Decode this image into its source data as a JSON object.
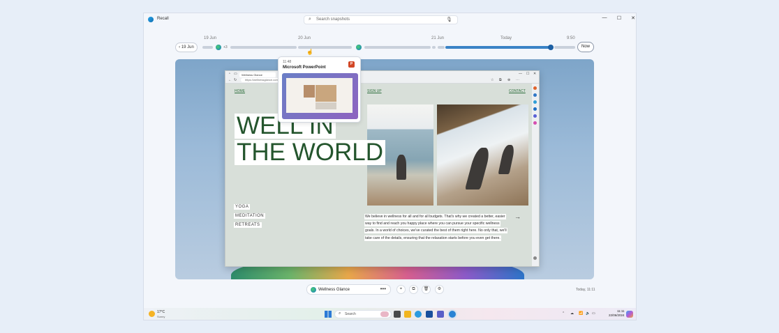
{
  "titlebar": {
    "app_name": "Recall",
    "search_placeholder": "Search snapshots",
    "search_icon": "search-icon",
    "mic_icon": "microphone-icon",
    "controls": [
      "minimize-icon",
      "maximize-icon",
      "close-icon"
    ]
  },
  "timeline": {
    "dates": [
      "19 Jun",
      "20 Jun",
      "21 Jun",
      "Today",
      "9:50"
    ],
    "back_label": "19 Jun",
    "now_label": "Now",
    "more_count": "+3"
  },
  "hover_card": {
    "time": "11:48",
    "app": "Microsoft PowerPoint",
    "app_badge": "P"
  },
  "browser": {
    "tab_title": "Wellness Glance",
    "url": "https://wellnessglance.com",
    "nav": [
      "HOME",
      "SIGN UP",
      "CONTACT"
    ],
    "headline_lines": [
      "WELL IN",
      "THE WORLD"
    ],
    "tags": [
      "YOGA",
      "MEDITATION",
      "RETREATS"
    ],
    "blurb_lines": [
      "We believe in wellness for all and for all budgets. That's why we created a better, easier",
      "way to find and reach you happy place where you can pursue your specific wellness",
      "goals. In a world of choices, we've curated the best of them right here. No only that, we'll",
      "take care of the details, ensuring that the relaxation starts before you even get there."
    ],
    "arrow": "→"
  },
  "bottom_bar": {
    "title": "Wellness Glance",
    "more": "•••",
    "time": "Today, 11:11",
    "actions": [
      "click-to-do-icon",
      "copy-icon",
      "delete-icon",
      "settings-icon"
    ]
  },
  "taskbar": {
    "weather_temp": "17°C",
    "weather_desc": "Sunny",
    "search_label": "Search",
    "time": "11:11",
    "date": "22/06/2024"
  }
}
